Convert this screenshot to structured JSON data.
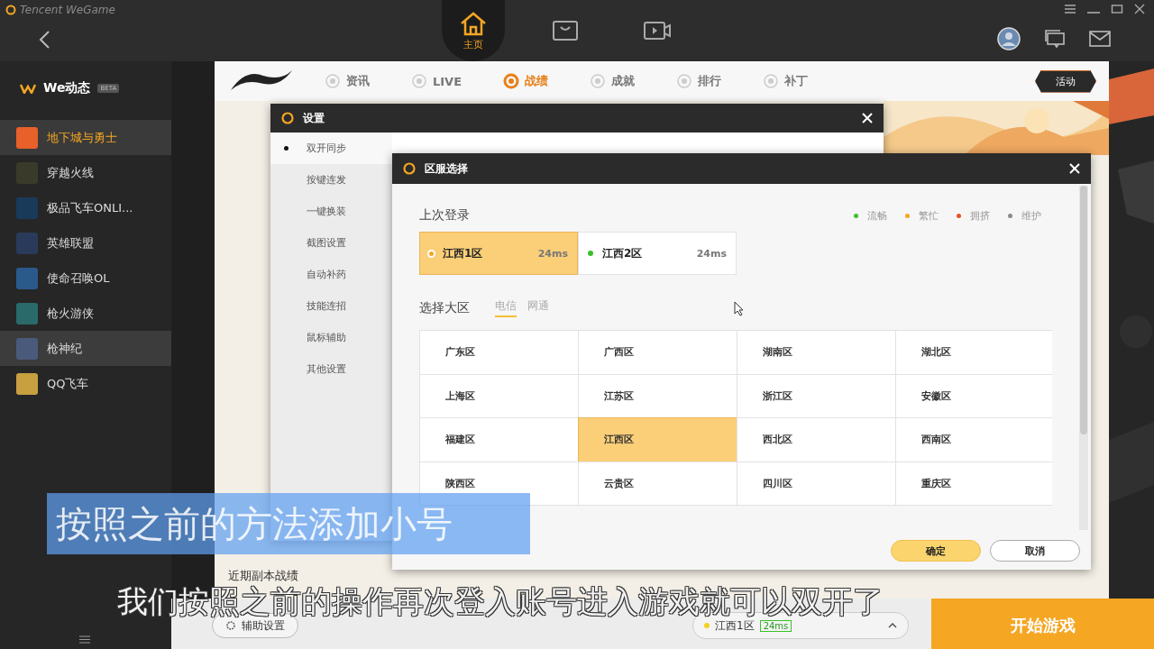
{
  "window": {
    "title": "Tencent WeGame"
  },
  "top_tabs": [
    {
      "label": "主页",
      "selected": true
    },
    {
      "selected": false
    },
    {
      "selected": false
    }
  ],
  "sidebar": {
    "header": "We动态",
    "badge": "BETA",
    "items": [
      {
        "label": "地下城与勇士",
        "selected": true,
        "highlighted": false
      },
      {
        "label": "穿越火线",
        "selected": false,
        "highlighted": false
      },
      {
        "label": "极品飞车ONLI...",
        "selected": false,
        "highlighted": false
      },
      {
        "label": "英雄联盟",
        "selected": false,
        "highlighted": false
      },
      {
        "label": "使命召唤OL",
        "selected": false,
        "highlighted": false
      },
      {
        "label": "枪火游侠",
        "selected": false,
        "highlighted": false
      },
      {
        "label": "枪神纪",
        "selected": false,
        "highlighted": true
      },
      {
        "label": "QQ飞车",
        "selected": false,
        "highlighted": false
      }
    ]
  },
  "game_tabs": [
    {
      "label": "资讯",
      "selected": false
    },
    {
      "label": "LIVE",
      "selected": false
    },
    {
      "label": "战绩",
      "selected": true
    },
    {
      "label": "成就",
      "selected": false
    },
    {
      "label": "排行",
      "selected": false
    },
    {
      "label": "补丁",
      "selected": false
    }
  ],
  "event_button": "活动",
  "content": {
    "section_title": "近期副本战绩"
  },
  "settings_dialog": {
    "title": "设置",
    "menu": [
      {
        "label": "双开同步",
        "selected": true
      },
      {
        "label": "按键连发",
        "selected": false
      },
      {
        "label": "一键换装",
        "selected": false
      },
      {
        "label": "截图设置",
        "selected": false
      },
      {
        "label": "自动补药",
        "selected": false
      },
      {
        "label": "技能连招",
        "selected": false
      },
      {
        "label": "鼠标辅助",
        "selected": false
      },
      {
        "label": "其他设置",
        "selected": false
      }
    ]
  },
  "region_dialog": {
    "title": "区服选择",
    "last_login_title": "上次登录",
    "legend": [
      {
        "label": "流畅",
        "color": "#3bbf2a"
      },
      {
        "label": "繁忙",
        "color": "#f5a623"
      },
      {
        "label": "拥挤",
        "color": "#e8502a"
      },
      {
        "label": "维护",
        "color": "#8a8a8a"
      }
    ],
    "last_servers": [
      {
        "name": "江西1区",
        "ping": "24ms",
        "selected": true,
        "color": "#f5a623"
      },
      {
        "name": "江西2区",
        "ping": "24ms",
        "selected": false,
        "color": "#3bbf2a"
      }
    ],
    "region_title": "选择大区",
    "isp_tabs": [
      {
        "label": "电信",
        "selected": true
      },
      {
        "label": "网通",
        "selected": false
      }
    ],
    "regions": [
      {
        "label": "广东区",
        "selected": false
      },
      {
        "label": "广西区",
        "selected": false
      },
      {
        "label": "湖南区",
        "selected": false
      },
      {
        "label": "湖北区",
        "selected": false
      },
      {
        "label": "上海区",
        "selected": false
      },
      {
        "label": "江苏区",
        "selected": false
      },
      {
        "label": "浙江区",
        "selected": false
      },
      {
        "label": "安徽区",
        "selected": false
      },
      {
        "label": "福建区",
        "selected": false
      },
      {
        "label": "江西区",
        "selected": true
      },
      {
        "label": "西北区",
        "selected": false
      },
      {
        "label": "西南区",
        "selected": false
      },
      {
        "label": "陕西区",
        "selected": false
      },
      {
        "label": "云贵区",
        "selected": false
      },
      {
        "label": "四川区",
        "selected": false
      },
      {
        "label": "重庆区",
        "selected": false
      }
    ],
    "buttons": [
      {
        "label": "确定",
        "kind": "primary"
      },
      {
        "label": "取消",
        "kind": "secondary"
      }
    ]
  },
  "bottom_bar": {
    "assist_button": "辅助设置",
    "server": {
      "name": "江西1区",
      "ping": "24ms",
      "color": "#f5d020"
    },
    "start_button": "开始游戏"
  },
  "captions": [
    {
      "text": "按照之前的方法添加小号",
      "kind": "boxed"
    },
    {
      "text": "我们按照之前的操作再次登入账号进入游戏就可以双开了",
      "kind": "outline"
    }
  ]
}
